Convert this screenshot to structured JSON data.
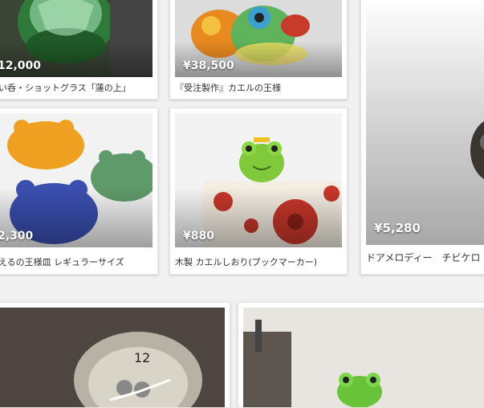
{
  "items": [
    {
      "price": "12,000",
      "title": "ぐい呑・ショットグラス「蓮の上」"
    },
    {
      "price": "¥38,500",
      "title": "『受注製作』カエルの王様"
    },
    {
      "price": "¥5,280",
      "title": "ドアメロディー　チビケロ"
    },
    {
      "price": "2,300",
      "title": "かえるの王様皿 レギュラーサイズ"
    },
    {
      "price": "¥880",
      "title": "木製 カエルしおり(ブックマーカー)"
    },
    {
      "price": "",
      "title": ""
    },
    {
      "price": "",
      "title": ""
    }
  ],
  "images": {
    "glass": "green-glass-lotus",
    "frog_king_glass": "glass-frog-king",
    "door_melody": "door-melody-frog",
    "plates": "frog-plates",
    "bookmark": "wood-frog-bookmark",
    "clock": "clock-image",
    "frog_photo": "frog-figure-photo"
  }
}
